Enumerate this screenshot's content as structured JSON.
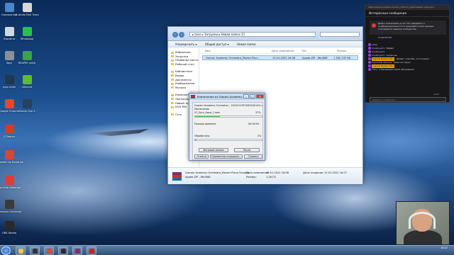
{
  "desktop": {
    "icons": [
      {
        "label": "Компьютер",
        "color": "#4a86c8"
      },
      {
        "label": "M-Audio Fast Track",
        "color": "#d8d8d8"
      },
      {
        "label": "Корзина",
        "color": "#cfd8e0"
      },
      {
        "label": "WhatsApp",
        "color": "#27c24c"
      },
      {
        "label": "Звук",
        "color": "#8a8f99"
      },
      {
        "label": "REAPER (x64)",
        "color": "#3aa34a"
      },
      {
        "label": "mpc-hc64",
        "color": "#22364f"
      },
      {
        "label": "uTorrent",
        "color": "#5bbf2a"
      },
      {
        "label": "Google Chrome",
        "color": "#e0463a"
      },
      {
        "label": "Studio One 5",
        "color": "#28415e"
      },
      {
        "label": "CCleaner",
        "color": "#d23a2f"
      },
      {
        "label": "Cakewalk by BandLab",
        "color": "#d9482b"
      },
      {
        "label": "BandLab Assistant",
        "color": "#e13a3a"
      },
      {
        "label": "Presonus Universal",
        "color": "#3a3a3a"
      },
      {
        "label": "OBS Studio",
        "color": "#2a2a2a"
      }
    ]
  },
  "explorer": {
    "breadcrumb": "▸ User ▸ Загрузки ▸ Новая папка (2)",
    "toolbar": [
      "Упорядочить ▾",
      "Общий доступ ▾",
      "Новая папка"
    ],
    "nav": {
      "favorites": [
        "Избранное",
        "Загрузки",
        "Недавние места",
        "Рабочий стол"
      ],
      "libraries": [
        "Библиотеки",
        "Видео",
        "Документы",
        "Изображения",
        "Музыка"
      ],
      "computer": [
        "Компьютер",
        "Локальный диск",
        "Новый том",
        "DVD RW"
      ],
      "network": "Сеть"
    },
    "columns": {
      "name": "Имя",
      "date": "Дата изменения",
      "type": "Тип",
      "size": "Размер"
    },
    "file": {
      "name": "Grorain Academy Orchestra_Mozart Pian...",
      "date": "19.01.2022 16:08",
      "type": "Архив ZIP - WinRAR",
      "size": "1 342 237 КБ"
    },
    "details": {
      "name": "Grorain Academy Orchestra_Mozart Piano Sonatas",
      "date_label": "Дата изменения:",
      "date": "19.01.2022 16:08",
      "created_label": "Дата создания:",
      "created": "19.01.2022 16:07",
      "type": "Архив ZIP - WinRAR",
      "size_label": "Размер:",
      "size": "1,28 ГБ"
    }
  },
  "dialog": {
    "title": "Извлечение из Grorain Academy ...",
    "archive": "Grorain Academy Orchestra... 20220119T163530Z-001.zip",
    "action_label": "Извлечение",
    "current_file": "07_Spur_Aqua_1.wav",
    "current_pct": "37%",
    "current_progress": 0.37,
    "elapsed_label": "Прошло времени",
    "elapsed": "00:00:05",
    "processed_label": "Обработано",
    "processed_pct": "2%",
    "total_progress": 0.02,
    "btn_background": "Фоновый режим",
    "btn_pause": "Пауза",
    "btn_cancel": "Отмена",
    "btn_mode": "Параметры операции...",
    "btn_help": "Справка"
  },
  "chat": {
    "url": "https://studio.youtube.com/live_chat?v=_pqxrEu6Ko&is_popout=1",
    "header": "Интересные сообщения",
    "banner_text": "Добро пожаловать в чат! Не забывайте о конфиденциальности и защищайте свои данные. Соблюдайте правила сообщества.",
    "banner_link": "ПОДРОБНЕЕ",
    "messages": [
      {
        "author": "Vitaly",
        "text": "",
        "badge": false
      },
      {
        "author": "AlinaRoyalko",
        "text": "Привет",
        "badge": false
      },
      {
        "author": "AlinaRoyalko",
        "text": "",
        "badge": false
      },
      {
        "author": "AlinaRoyalko",
        "text": "жорик мю",
        "badge": false
      },
      {
        "author": "Сергей Мурзин Muz",
        "text": "Привет. Спасибо, что показал",
        "badge": true
      },
      {
        "author": "Анатолий Чепаков",
        "text": "Такое это звуки",
        "badge": false
      },
      {
        "author": "Сергей Мурзин Muz",
        "text": "",
        "badge": true
      },
      {
        "author": "Vitaly",
        "text": "Отвечающий порой обсуждения",
        "badge": false
      }
    ],
    "input_placeholder": "Введите сообщение...",
    "counter": "0/200"
  },
  "taskbar": {
    "buttons": [
      "explorer",
      "media",
      "chrome",
      "obs",
      "winrar",
      "record"
    ],
    "time": "16:10",
    "date": "19.01.2022"
  }
}
